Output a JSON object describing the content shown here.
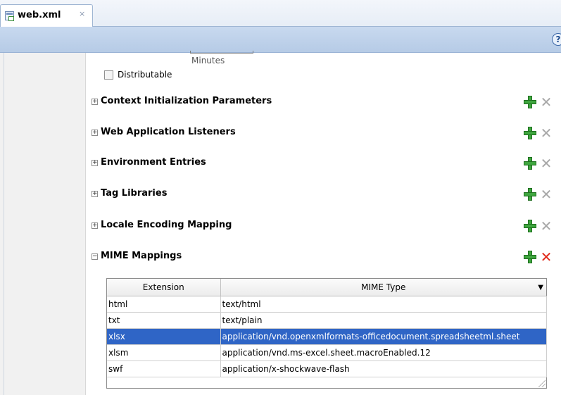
{
  "tab": {
    "title": "web.xml",
    "close": "×"
  },
  "toolbar": {
    "help": "?"
  },
  "session": {
    "minutes_label": "Minutes",
    "distributable_label": "Distributable"
  },
  "sections": [
    {
      "title": "Context Initialization Parameters",
      "expanded": false,
      "toggle": "+"
    },
    {
      "title": "Web Application Listeners",
      "expanded": false,
      "toggle": "+"
    },
    {
      "title": "Environment Entries",
      "expanded": false,
      "toggle": "+"
    },
    {
      "title": "Tag Libraries",
      "expanded": false,
      "toggle": "+"
    },
    {
      "title": "Locale Encoding Mapping",
      "expanded": false,
      "toggle": "+"
    },
    {
      "title": "MIME Mappings",
      "expanded": true,
      "toggle": "−"
    }
  ],
  "icons": {
    "add": "green-plus-icon",
    "remove": "x-icon"
  },
  "mime_table": {
    "columns": [
      "Extension",
      "MIME Type"
    ],
    "rows": [
      {
        "extension": "html",
        "mime": "text/html",
        "selected": false
      },
      {
        "extension": "txt",
        "mime": "text/plain",
        "selected": false
      },
      {
        "extension": "xlsx",
        "mime": "application/vnd.openxmlformats-officedocument.spreadsheetml.sheet",
        "selected": true
      },
      {
        "extension": "xlsm",
        "mime": "application/vnd.ms-excel.sheet.macroEnabled.12",
        "selected": false
      },
      {
        "extension": "swf",
        "mime": "application/x-shockwave-flash",
        "selected": false
      }
    ],
    "sort_arrow": "▼"
  },
  "colors": {
    "selection": "#2f65c6",
    "band": "#c8d9ef",
    "delete_active": "#e02a1a"
  }
}
